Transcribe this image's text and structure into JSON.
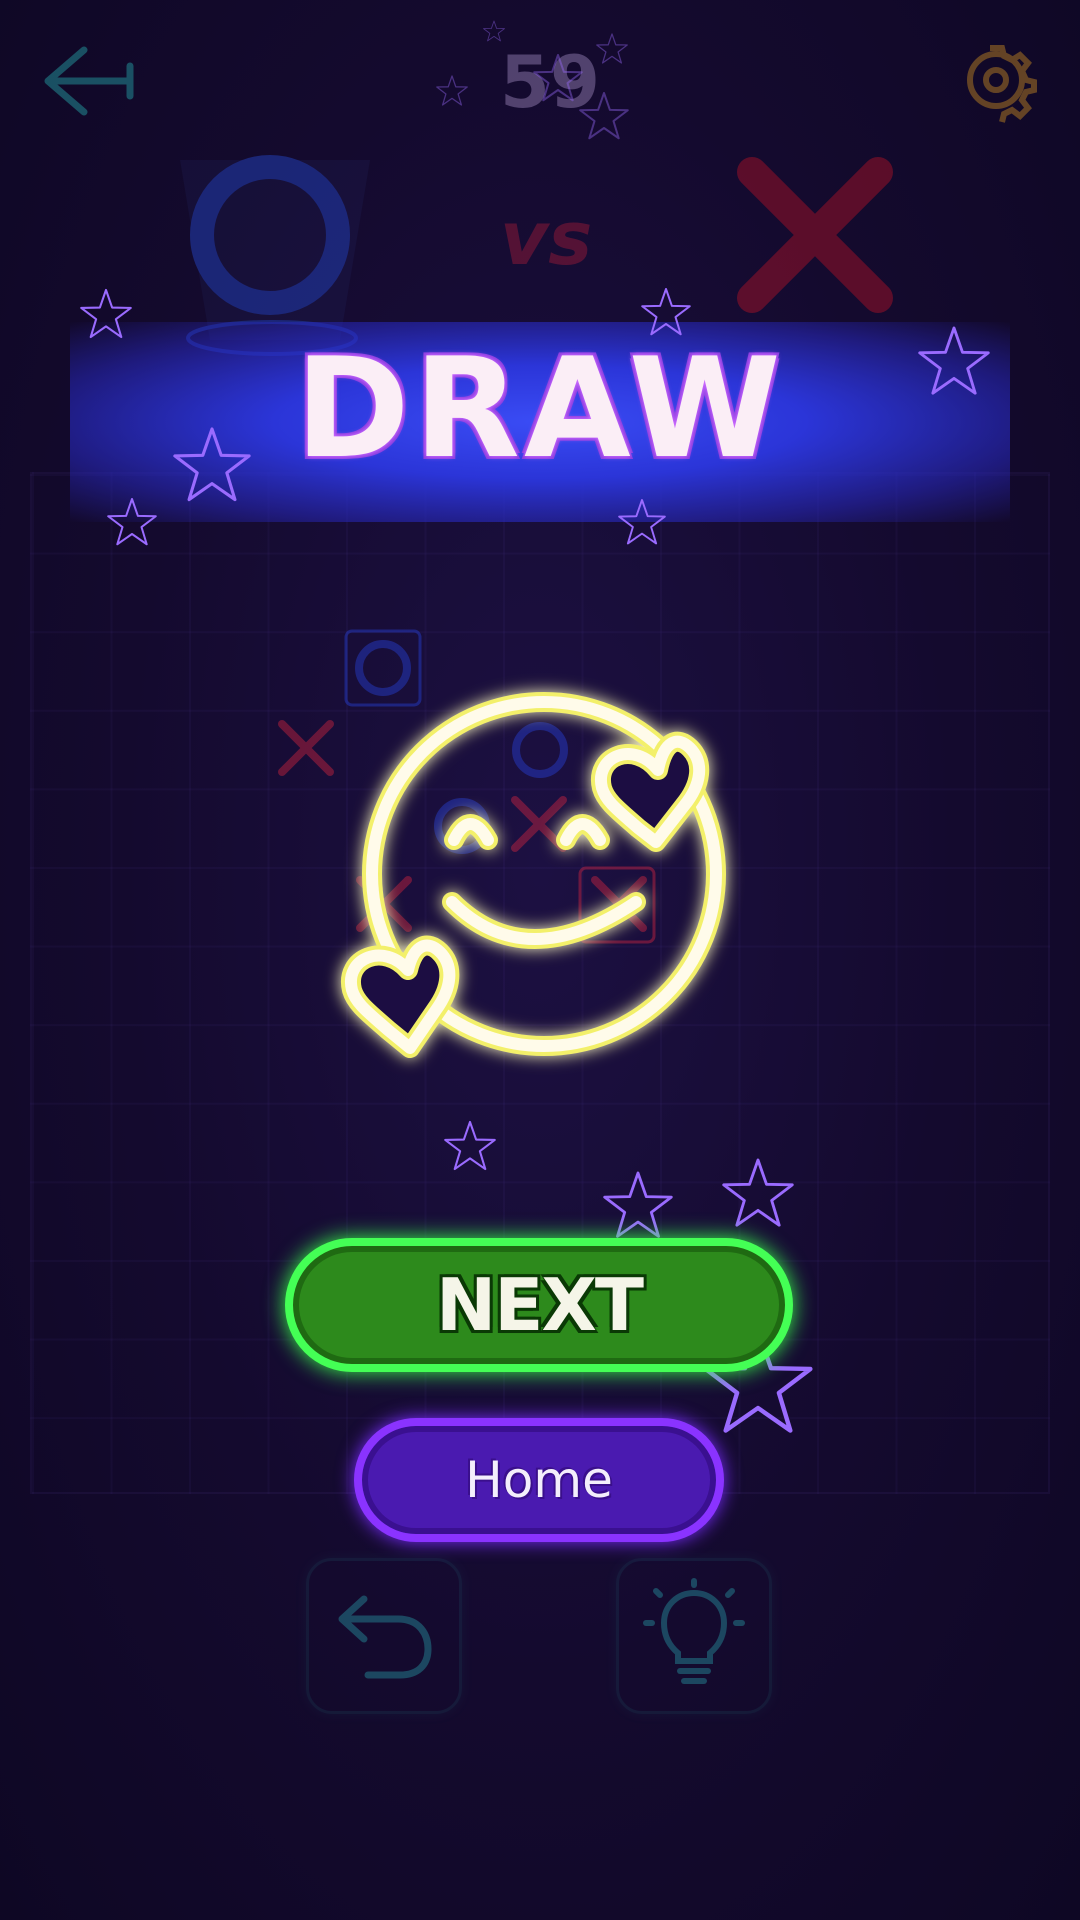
{
  "header": {
    "score": "59",
    "back_icon": "back-arrow-icon",
    "settings_icon": "gear-icon"
  },
  "versus": {
    "player_one_symbol": "O",
    "vs_label": "vs",
    "player_two_symbol": "X"
  },
  "result": {
    "title": "DRAW",
    "emoji_icon": "smiling-face-with-hearts-icon"
  },
  "buttons": {
    "next_label": "NEXT",
    "home_label": "Home"
  },
  "tools": {
    "undo_icon": "undo-icon",
    "hint_icon": "lightbulb-icon"
  },
  "colors": {
    "background": "#140a2e",
    "banner": "#2b35d8",
    "next_button": "#2d8a1c",
    "next_border": "#44ff55",
    "home_button": "#4a1ab0",
    "home_border": "#8a33ff",
    "emoji": "#f6f3a0"
  }
}
